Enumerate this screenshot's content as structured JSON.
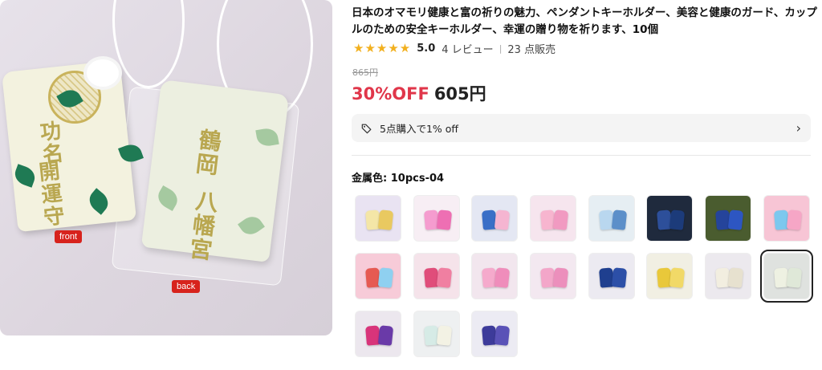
{
  "product": {
    "title": "日本のオマモリ健康と富の祈りの魅力、ペンダントキーホルダー、美容と健康のガード、カップルのための安全キーホルダー、幸運の贈り物を祈ります、10個",
    "rating": {
      "stars": "★★★★★",
      "score": "5.0",
      "reviews": "4 レビュー",
      "sold": "23 点販売"
    },
    "original_price": "865円",
    "discount_label": "30%OFF",
    "price": "605円",
    "promo": {
      "text": "5点購入で1% off",
      "icon": "tag-icon"
    },
    "variant": {
      "label": "金属色: 10pcs-04",
      "selected_index": 15
    }
  },
  "image": {
    "amulet_front_text_col1": "功名",
    "amulet_front_text_col2": "開運守",
    "amulet_back_text_col1": "鶴岡",
    "amulet_back_text_col2": "八幡宮",
    "front_tag": "front",
    "back_tag": "back"
  },
  "variants": [
    {
      "bg": "#e9e3f2",
      "c1": "#f4e6a7",
      "c2": "#e9c960"
    },
    {
      "bg": "#f7eef4",
      "c1": "#f59ccf",
      "c2": "#ee6fb3"
    },
    {
      "bg": "#e4e7f3",
      "c1": "#3a6fc7",
      "c2": "#f5b5d1"
    },
    {
      "bg": "#f6e5ee",
      "c1": "#f7b5cf",
      "c2": "#f19ac1"
    },
    {
      "bg": "#e6eef3",
      "c1": "#b9d7ef",
      "c2": "#5c8fc9"
    },
    {
      "bg": "#1f2a3d",
      "c1": "#2d4f9a",
      "c2": "#1c3b7a"
    },
    {
      "bg": "#4a5c2f",
      "c1": "#25449b",
      "c2": "#2d56c2"
    },
    {
      "bg": "#f7c5d5",
      "c1": "#7cc8ee",
      "c2": "#f6a6c6"
    },
    {
      "bg": "#f7cbd8",
      "c1": "#e65a52",
      "c2": "#8fd0f0"
    },
    {
      "bg": "#f5e3ea",
      "c1": "#e04d7a",
      "c2": "#f07fa1"
    },
    {
      "bg": "#f2e6ee",
      "c1": "#f5aacc",
      "c2": "#ef8dbb"
    },
    {
      "bg": "#f3e8f0",
      "c1": "#f3a6c9",
      "c2": "#ec8fbc"
    },
    {
      "bg": "#eceaf1",
      "c1": "#1f3f8f",
      "c2": "#2c4fa7"
    },
    {
      "bg": "#f1efe3",
      "c1": "#e9c83a",
      "c2": "#f1d967"
    },
    {
      "bg": "#ece9ee",
      "c1": "#f2eee0",
      "c2": "#e7e1cf"
    },
    {
      "bg": "#dfe2df",
      "c1": "#eef1e2",
      "c2": "#dfe8d8"
    },
    {
      "bg": "#ece7ee",
      "c1": "#d8347a",
      "c2": "#6a3aa8"
    },
    {
      "bg": "#eef0f1",
      "c1": "#d6ebe6",
      "c2": "#f3f2e4"
    },
    {
      "bg": "#ecebf3",
      "c1": "#3d3b9a",
      "c2": "#5a52b7"
    }
  ]
}
